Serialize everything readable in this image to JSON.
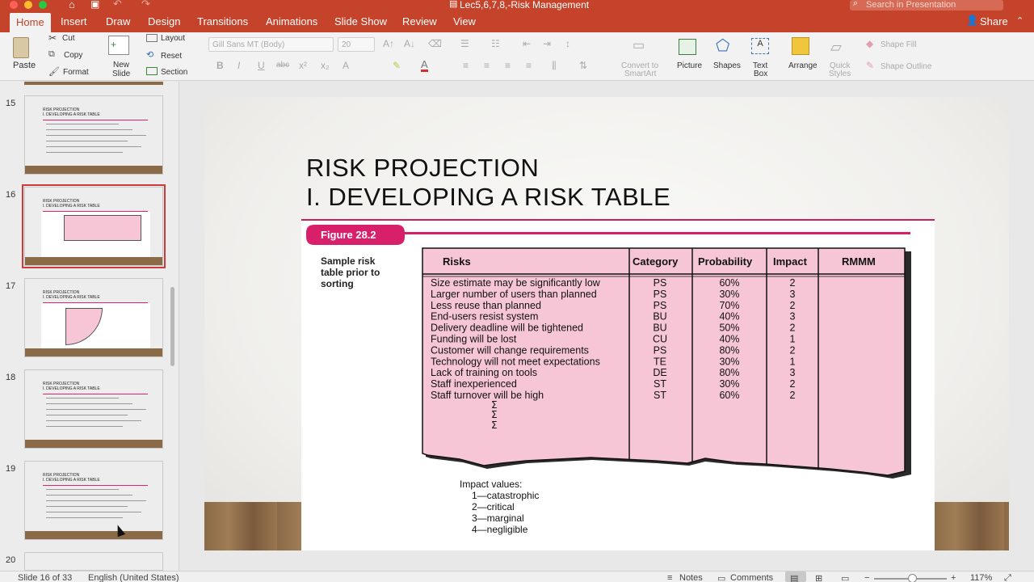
{
  "window": {
    "title": "Lec5,6,7,8,-Risk Management",
    "search_placeholder": "Search in Presentation"
  },
  "tabs": [
    "Home",
    "Insert",
    "Draw",
    "Design",
    "Transitions",
    "Animations",
    "Slide Show",
    "Review",
    "View"
  ],
  "share": "Share",
  "ribbon": {
    "paste": "Paste",
    "cut": "Cut",
    "copy": "Copy",
    "format": "Format",
    "new_slide": "New",
    "new_slide2": "Slide",
    "layout": "Layout",
    "reset": "Reset",
    "section": "Section",
    "font": "Gill Sans MT (Body)",
    "size": "20",
    "convert": "Convert to",
    "smartart": "SmartArt",
    "picture": "Picture",
    "shapes": "Shapes",
    "textbox": "Text",
    "textbox2": "Box",
    "arrange": "Arrange",
    "quick": "Quick",
    "styles": "Styles",
    "shape_fill": "Shape Fill",
    "shape_outline": "Shape Outline"
  },
  "slides": [
    {
      "num": "15",
      "title1": "RISK PROJECTION",
      "title2": "I. DEVELOPING A RISK TABLE"
    },
    {
      "num": "16",
      "title1": "RISK PROJECTION",
      "title2": "I. DEVELOPING A RISK TABLE"
    },
    {
      "num": "17",
      "title1": "RISK PROJECTION",
      "title2": "I. DEVELOPING A RISK TABLE"
    },
    {
      "num": "18",
      "title1": "RISK PROJECTION",
      "title2": "I. DEVELOPING A RISK TABLE"
    },
    {
      "num": "19",
      "title1": "RISK PROJECTION",
      "title2": "I. DEVELOPING A RISK TABLE"
    },
    {
      "num": "20",
      "title1": "",
      "title2": ""
    }
  ],
  "slide": {
    "title1": "RISK PROJECTION",
    "title2": "I. DEVELOPING A RISK TABLE",
    "figure_label": "Figure 28.2",
    "caption": [
      "Sample risk",
      "table prior to",
      "sorting"
    ],
    "headers": [
      "Risks",
      "Category",
      "Probability",
      "Impact",
      "RMMM"
    ],
    "rows": [
      [
        "Size estimate may be significantly low",
        "PS",
        "60%",
        "2"
      ],
      [
        "Larger number of users than planned",
        "PS",
        "30%",
        "3"
      ],
      [
        "Less reuse than planned",
        "PS",
        "70%",
        "2"
      ],
      [
        "End-users resist system",
        "BU",
        "40%",
        "3"
      ],
      [
        "Delivery deadline will be tightened",
        "BU",
        "50%",
        "2"
      ],
      [
        "Funding will be lost",
        "CU",
        "40%",
        "1"
      ],
      [
        "Customer will change requirements",
        "PS",
        "80%",
        "2"
      ],
      [
        "Technology will not meet expectations",
        "TE",
        "30%",
        "1"
      ],
      [
        "Lack of training on tools",
        "DE",
        "80%",
        "3"
      ],
      [
        "Staff inexperienced",
        "ST",
        "30%",
        "2"
      ],
      [
        "Staff turnover will be high",
        "ST",
        "60%",
        "2"
      ]
    ],
    "sigma": "Σ",
    "impact_title": "Impact values:",
    "impact_values": [
      "1—catastrophic",
      "2—critical",
      "3—marginal",
      "4—negligible"
    ]
  },
  "status": {
    "slide": "Slide 16 of 33",
    "lang": "English (United States)",
    "notes": "Notes",
    "comments": "Comments",
    "zoom": "117%"
  },
  "colors": {
    "accent": "#c5432a",
    "figure_pink": "#f7c6d6",
    "figure_magenta": "#d8206a"
  }
}
